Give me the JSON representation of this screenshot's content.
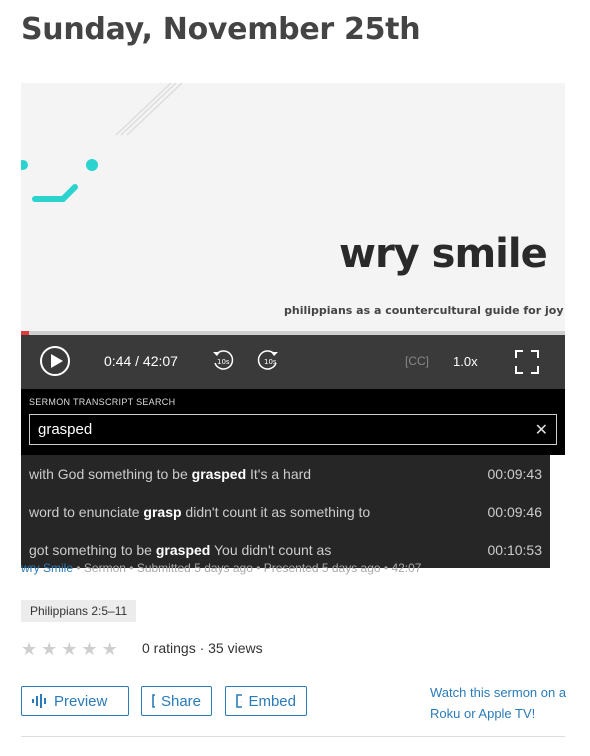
{
  "page": {
    "title": "Sunday, November 25th"
  },
  "video": {
    "slide_title": "wry smile",
    "slide_subtitle": "philippians as a countercultural guide for joy",
    "progress_fraction": 0.015,
    "current_time": "0:44",
    "duration": "42:07",
    "time_separator": "/",
    "skip_back_label": "10s",
    "skip_forward_label": "10s",
    "cc_label": "[CC]",
    "speed_label": "1.0x",
    "accent_color": "#2bd3cf"
  },
  "transcript": {
    "label": "SERMON TRANSCRIPT SEARCH",
    "query": "grasped",
    "clear_icon": "close-icon",
    "results": [
      {
        "before": "with God something to be ",
        "match": "grasped",
        "after": " It's a hard",
        "time": "00:09:43"
      },
      {
        "before": "word to enunciate ",
        "match": "grasp",
        "after": " didn't count it as something to",
        "time": "00:09:46"
      },
      {
        "before": "got something to be ",
        "match": "grasped",
        "after": " You didn't count as",
        "time": "00:10:53"
      }
    ]
  },
  "sermon_meta": {
    "series": "wry Smile",
    "type": "Sermon",
    "submitted": "Submitted 5 days ago",
    "presented": "Presented 5 days ago",
    "length": "42:07",
    "separator": "•"
  },
  "scripture_tag": "Philippians 2:5–11",
  "rating": {
    "stars_filled": 0,
    "stars_total": 5,
    "text": "0 ratings · 35 views"
  },
  "actions": {
    "preview_label": "Preview",
    "share_label": "Share",
    "embed_label": "Embed",
    "watch_link": "Watch this sermon on a Roku or Apple TV!"
  },
  "colors": {
    "link": "#2b7bb9",
    "progress": "#e03a3e"
  }
}
